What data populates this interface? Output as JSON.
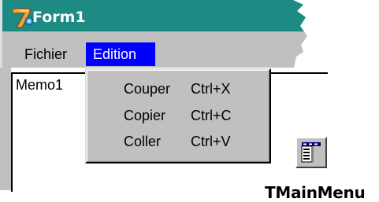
{
  "form": {
    "title": "Form1"
  },
  "menubar": {
    "items": [
      {
        "label": "Fichier"
      },
      {
        "label": "Edition"
      }
    ]
  },
  "memo": {
    "text": "Memo1"
  },
  "dropdown": {
    "items": [
      {
        "label": "Couper",
        "shortcut": "Ctrl+X"
      },
      {
        "label": "Copier",
        "shortcut": "Ctrl+C"
      },
      {
        "label": "Coller",
        "shortcut": "Ctrl+V"
      }
    ]
  },
  "component": {
    "caption": "TMainMenu",
    "icon": "main-menu-component-icon"
  },
  "colors": {
    "titlebar": "#1e8a84",
    "menu_highlight": "#0000ff",
    "face": "#c0c0c0"
  }
}
